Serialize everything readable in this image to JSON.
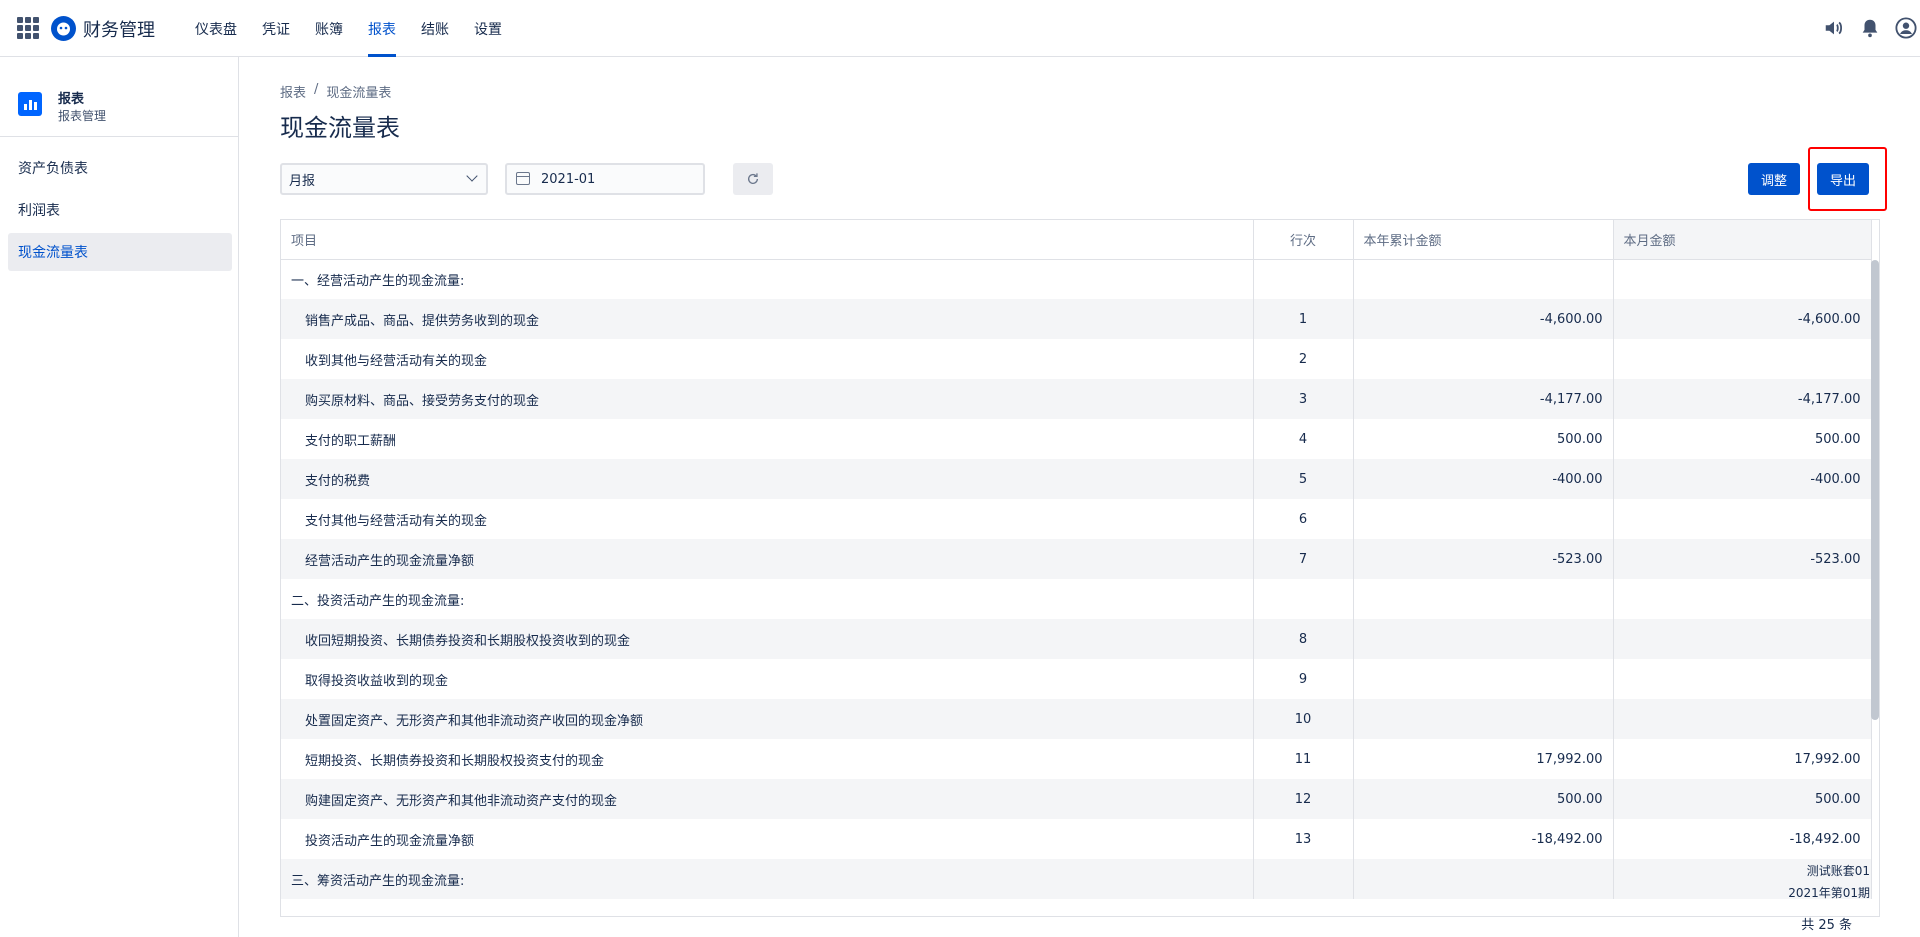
{
  "app": {
    "brand": "财务管理"
  },
  "nav": [
    {
      "label": "仪表盘",
      "active": false
    },
    {
      "label": "凭证",
      "active": false
    },
    {
      "label": "账簿",
      "active": false
    },
    {
      "label": "报表",
      "active": true
    },
    {
      "label": "结账",
      "active": false
    },
    {
      "label": "设置",
      "active": false
    }
  ],
  "topbar_icons": [
    "speaker-icon",
    "bell-icon",
    "user-avatar-icon"
  ],
  "sidebar": {
    "title": "报表",
    "subtitle": "报表管理",
    "items": [
      {
        "label": "资产负债表",
        "active": false
      },
      {
        "label": "利润表",
        "active": false
      },
      {
        "label": "现金流量表",
        "active": true
      }
    ]
  },
  "breadcrumb": {
    "parent": "报表",
    "separator": "/",
    "current": "现金流量表"
  },
  "page_title": "现金流量表",
  "filters": {
    "period_type": "月报",
    "date": "2021-01"
  },
  "actions": {
    "adjust": "调整",
    "export": "导出"
  },
  "table": {
    "headers": {
      "item": "项目",
      "line": "行次",
      "year": "本年累计金额",
      "month": "本月金额"
    },
    "rows": [
      {
        "item": "一、经营活动产生的现金流量:",
        "line": "",
        "year": "",
        "month": "",
        "section": true
      },
      {
        "item": "销售产成品、商品、提供劳务收到的现金",
        "line": "1",
        "year": "-4,600.00",
        "month": "-4,600.00"
      },
      {
        "item": "收到其他与经营活动有关的现金",
        "line": "2",
        "year": "",
        "month": ""
      },
      {
        "item": "购买原材料、商品、接受劳务支付的现金",
        "line": "3",
        "year": "-4,177.00",
        "month": "-4,177.00"
      },
      {
        "item": "支付的职工薪酬",
        "line": "4",
        "year": "500.00",
        "month": "500.00"
      },
      {
        "item": "支付的税费",
        "line": "5",
        "year": "-400.00",
        "month": "-400.00"
      },
      {
        "item": "支付其他与经营活动有关的现金",
        "line": "6",
        "year": "",
        "month": ""
      },
      {
        "item": "经营活动产生的现金流量净额",
        "line": "7",
        "year": "-523.00",
        "month": "-523.00"
      },
      {
        "item": "二、投资活动产生的现金流量:",
        "line": "",
        "year": "",
        "month": "",
        "section": true
      },
      {
        "item": "收回短期投资、长期债券投资和长期股权投资收到的现金",
        "line": "8",
        "year": "",
        "month": ""
      },
      {
        "item": "取得投资收益收到的现金",
        "line": "9",
        "year": "",
        "month": ""
      },
      {
        "item": "处置固定资产、无形资产和其他非流动资产收回的现金净额",
        "line": "10",
        "year": "",
        "month": ""
      },
      {
        "item": "短期投资、长期债券投资和长期股权投资支付的现金",
        "line": "11",
        "year": "17,992.00",
        "month": "17,992.00"
      },
      {
        "item": "购建固定资产、无形资产和其他非流动资产支付的现金",
        "line": "12",
        "year": "500.00",
        "month": "500.00"
      },
      {
        "item": "投资活动产生的现金流量净额",
        "line": "13",
        "year": "-18,492.00",
        "month": "-18,492.00"
      },
      {
        "item": "三、筹资活动产生的现金流量:",
        "line": "",
        "year": "",
        "month": "",
        "section": true
      }
    ]
  },
  "footer": {
    "account": "测试账套01",
    "period": "2021年第01期",
    "total": "共 25 条"
  }
}
